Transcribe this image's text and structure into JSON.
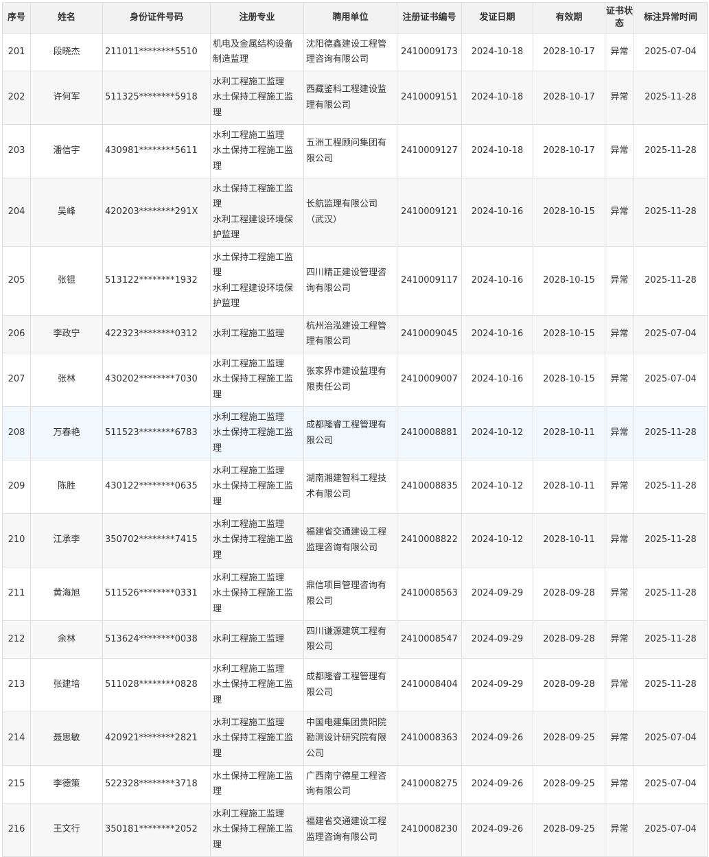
{
  "columns": {
    "seq": "序号",
    "name": "姓名",
    "id_no": "身份证件号码",
    "major": "注册专业",
    "employer": "聘用单位",
    "cert_no": "注册证书编号",
    "issue_date": "发证日期",
    "valid_until": "有效期",
    "cert_status": "证书状态",
    "abnormal_time": "标注异常时间"
  },
  "rows": [
    {
      "seq": "201",
      "name": "段晓杰",
      "id_no": "211011********5510",
      "major": "机电及金属结构设备制造监理",
      "employer": "沈阳德鑫建设工程管理咨询有限公司",
      "cert_no": "2410009173",
      "issue_date": "2024-10-18",
      "valid_until": "2028-10-17",
      "status": "异常",
      "abnormal_time": "2025-07-04"
    },
    {
      "seq": "202",
      "name": "许何军",
      "id_no": "511325********5918",
      "major": "水利工程施工监理\n水土保持工程施工监理",
      "employer": "西藏鉴科工程建设监理有限公司",
      "cert_no": "2410009151",
      "issue_date": "2024-10-18",
      "valid_until": "2028-10-17",
      "status": "异常",
      "abnormal_time": "2025-11-28"
    },
    {
      "seq": "203",
      "name": "潘信宇",
      "id_no": "430981********5611",
      "major": "水利工程施工监理\n水土保持工程施工监理",
      "employer": "五洲工程顾问集团有限公司",
      "cert_no": "2410009127",
      "issue_date": "2024-10-18",
      "valid_until": "2028-10-17",
      "status": "异常",
      "abnormal_time": "2025-11-28"
    },
    {
      "seq": "204",
      "name": "吴峰",
      "id_no": "420203********291X",
      "major": "水土保持工程施工监理\n水利工程建设环境保护监理",
      "employer": "长航监理有限公司（武汉）",
      "cert_no": "2410009121",
      "issue_date": "2024-10-16",
      "valid_until": "2028-10-15",
      "status": "异常",
      "abnormal_time": "2025-11-28"
    },
    {
      "seq": "205",
      "name": "张锟",
      "id_no": "513122********1932",
      "major": "水土保持工程施工监理\n水利工程建设环境保护监理",
      "employer": "四川精正建设管理咨询有限公司",
      "cert_no": "2410009117",
      "issue_date": "2024-10-16",
      "valid_until": "2028-10-15",
      "status": "异常",
      "abnormal_time": "2025-11-28"
    },
    {
      "seq": "206",
      "name": "李政宁",
      "id_no": "422323********0312",
      "major": "水利工程施工监理",
      "employer": "杭州治泓建设工程管理有限公司",
      "cert_no": "2410009045",
      "issue_date": "2024-10-16",
      "valid_until": "2028-10-15",
      "status": "异常",
      "abnormal_time": "2025-07-04"
    },
    {
      "seq": "207",
      "name": "张林",
      "id_no": "430202********7030",
      "major": "水利工程施工监理\n水土保持工程施工监理",
      "employer": "张家界市建设监理有限责任公司",
      "cert_no": "2410009007",
      "issue_date": "2024-10-16",
      "valid_until": "2028-10-15",
      "status": "异常",
      "abnormal_time": "2025-07-04"
    },
    {
      "seq": "208",
      "name": "万春艳",
      "id_no": "511523********6783",
      "major": "水利工程施工监理\n水土保持工程施工监理",
      "employer": "成都隆睿工程管理有限公司",
      "cert_no": "2410008881",
      "issue_date": "2024-10-12",
      "valid_until": "2028-10-11",
      "status": "异常",
      "abnormal_time": "2025-11-28"
    },
    {
      "seq": "209",
      "name": "陈胜",
      "id_no": "430122********0635",
      "major": "水利工程施工监理\n水土保持工程施工监理",
      "employer": "湖南湘建智科工程技术有限公司",
      "cert_no": "2410008835",
      "issue_date": "2024-10-12",
      "valid_until": "2028-10-11",
      "status": "异常",
      "abnormal_time": "2025-11-28"
    },
    {
      "seq": "210",
      "name": "江承李",
      "id_no": "350702********7415",
      "major": "水利工程施工监理\n水土保持工程施工监理",
      "employer": "福建省交通建设工程监理咨询有限公司",
      "cert_no": "2410008822",
      "issue_date": "2024-10-12",
      "valid_until": "2028-10-11",
      "status": "异常",
      "abnormal_time": "2025-11-28"
    },
    {
      "seq": "211",
      "name": "黄海旭",
      "id_no": "511526********0331",
      "major": "水利工程施工监理\n水土保持工程施工监理",
      "employer": "鼎信项目管理咨询有限公司",
      "cert_no": "2410008563",
      "issue_date": "2024-09-29",
      "valid_until": "2028-09-28",
      "status": "异常",
      "abnormal_time": "2025-11-28"
    },
    {
      "seq": "212",
      "name": "余林",
      "id_no": "513624********0038",
      "major": "水利工程施工监理",
      "employer": "四川谦源建筑工程有限公司",
      "cert_no": "2410008547",
      "issue_date": "2024-09-29",
      "valid_until": "2028-09-28",
      "status": "异常",
      "abnormal_time": "2025-11-28"
    },
    {
      "seq": "213",
      "name": "张建培",
      "id_no": "511028********0828",
      "major": "水利工程施工监理\n水土保持工程施工监理",
      "employer": "成都隆睿工程管理有限公司",
      "cert_no": "2410008404",
      "issue_date": "2024-09-29",
      "valid_until": "2028-09-28",
      "status": "异常",
      "abnormal_time": "2025-11-28"
    },
    {
      "seq": "214",
      "name": "聂思敏",
      "id_no": "420921********2821",
      "major": "水利工程施工监理\n水土保持工程施工监理",
      "employer": "中国电建集团贵阳院勘测设计研究院有限公司",
      "cert_no": "2410008363",
      "issue_date": "2024-09-26",
      "valid_until": "2028-09-25",
      "status": "异常",
      "abnormal_time": "2025-07-04"
    },
    {
      "seq": "215",
      "name": "李德策",
      "id_no": "522328********3718",
      "major": "水土保持工程施工监理",
      "employer": "广西南宁德星工程咨询有限公司",
      "cert_no": "2410008275",
      "issue_date": "2024-09-26",
      "valid_until": "2028-09-25",
      "status": "异常",
      "abnormal_time": "2025-07-04"
    },
    {
      "seq": "216",
      "name": "王文行",
      "id_no": "350181********2052",
      "major": "水利工程施工监理\n水土保持工程施工监理",
      "employer": "福建省交通建设工程监理咨询有限公司",
      "cert_no": "2410008230",
      "issue_date": "2024-09-26",
      "valid_until": "2028-09-25",
      "status": "异常",
      "abnormal_time": "2025-07-04"
    }
  ]
}
